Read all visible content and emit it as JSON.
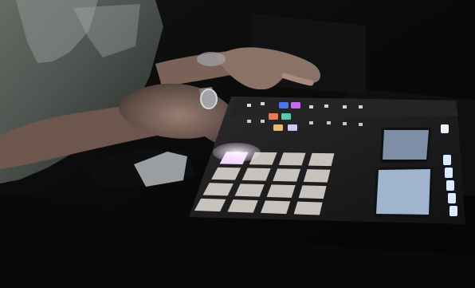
{
  "scene": {
    "background": "#060606",
    "device_body": "#1a1a1b",
    "pad_unlit": "#d6d0ca",
    "pad_active": "#f3d6ff",
    "screen_bg": "#7f8fa6",
    "screen_accent": "#8cc9ff",
    "knob_glow": "#ffffff"
  },
  "pads": {
    "rows": 4,
    "cols": 4,
    "lit_index": 0
  },
  "color_pads": [
    "#4a7bff",
    "#d46cff",
    "#ff7a4f",
    "#53d9b4",
    "#f2c46f",
    "#d9d1ff"
  ]
}
